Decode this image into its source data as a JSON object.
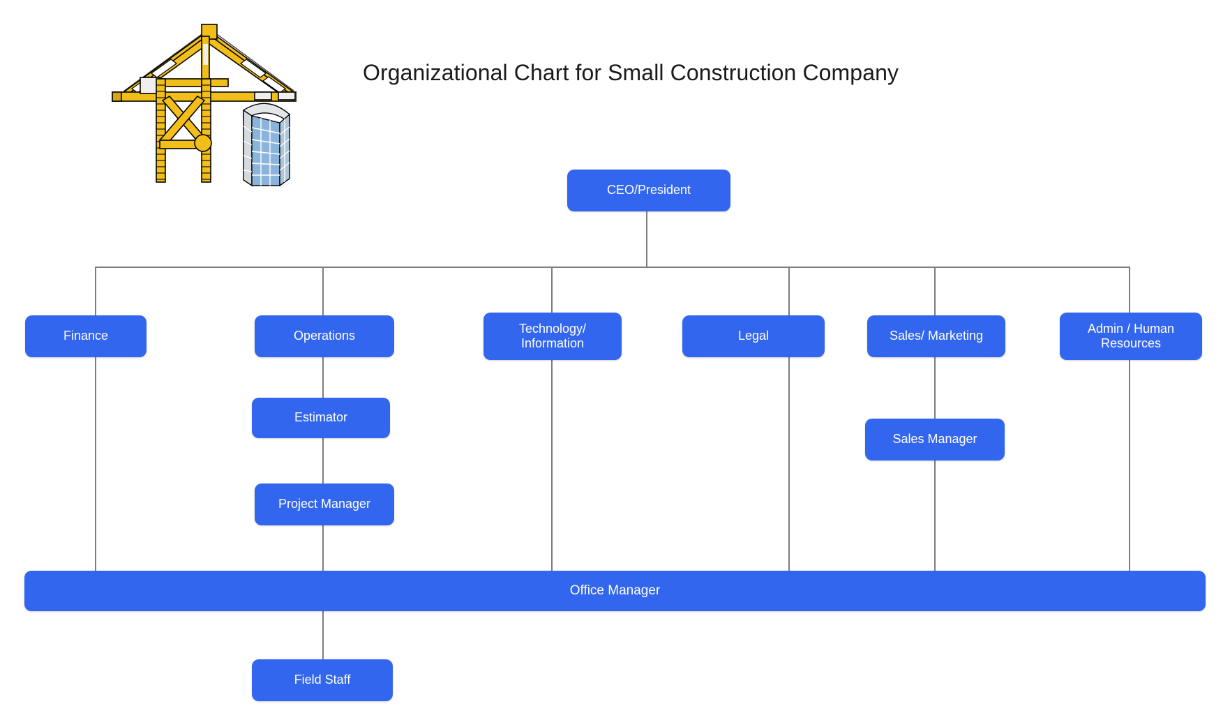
{
  "title": "Organizational Chart for Small Construction Company",
  "theme": {
    "node_fill": "#3366EE",
    "node_text": "#FFFFFF",
    "line_color": "#7D7D7D",
    "background": "#FFFFFF",
    "crane_yellow": "#F2BE1A",
    "crane_outline": "#000000",
    "building_glass": "#8AB4DC",
    "building_body": "#E6E8EA"
  },
  "illustration": {
    "name": "tower-crane-and-building",
    "description": "Yellow tower crane beside a blue-glass high-rise building"
  },
  "nodes": {
    "ceo": "CEO/President",
    "finance": "Finance",
    "operations": "Operations",
    "technology": "Technology/\nInformation",
    "technology_line1": "Technology/",
    "technology_line2": "Information",
    "legal": "Legal",
    "sales_marketing": "Sales/ Marketing",
    "admin_hr_line1": "Admin / Human",
    "admin_hr_line2": "Resources",
    "estimator": "Estimator",
    "project_manager": "Project Manager",
    "sales_manager": "Sales Manager",
    "office_manager": "Office Manager",
    "field_staff": "Field Staff"
  },
  "chart_data": {
    "type": "diagram",
    "subtype": "organizational-chart",
    "title": "Organizational Chart for Small Construction Company",
    "root": "CEO/President",
    "levels": [
      {
        "level": 1,
        "nodes": [
          "CEO/President"
        ]
      },
      {
        "level": 2,
        "nodes": [
          "Finance",
          "Operations",
          "Technology/ Information",
          "Legal",
          "Sales/ Marketing",
          "Admin / Human Resources"
        ]
      },
      {
        "level": 3,
        "nodes": [
          "Estimator",
          "Sales Manager"
        ]
      },
      {
        "level": 4,
        "nodes": [
          "Project Manager"
        ]
      },
      {
        "level": 5,
        "nodes": [
          "Office Manager"
        ]
      },
      {
        "level": 6,
        "nodes": [
          "Field Staff"
        ]
      }
    ],
    "edges": [
      {
        "from": "CEO/President",
        "to": "Finance"
      },
      {
        "from": "CEO/President",
        "to": "Operations"
      },
      {
        "from": "CEO/President",
        "to": "Technology/ Information"
      },
      {
        "from": "CEO/President",
        "to": "Legal"
      },
      {
        "from": "CEO/President",
        "to": "Sales/ Marketing"
      },
      {
        "from": "CEO/President",
        "to": "Admin / Human Resources"
      },
      {
        "from": "Operations",
        "to": "Estimator"
      },
      {
        "from": "Estimator",
        "to": "Project Manager"
      },
      {
        "from": "Project Manager",
        "to": "Office Manager"
      },
      {
        "from": "Sales/ Marketing",
        "to": "Sales Manager"
      },
      {
        "from": "Sales Manager",
        "to": "Office Manager"
      },
      {
        "from": "Finance",
        "to": "Office Manager"
      },
      {
        "from": "Technology/ Information",
        "to": "Office Manager"
      },
      {
        "from": "Legal",
        "to": "Office Manager"
      },
      {
        "from": "Admin / Human Resources",
        "to": "Office Manager"
      },
      {
        "from": "Office Manager",
        "to": "Field Staff"
      }
    ]
  }
}
